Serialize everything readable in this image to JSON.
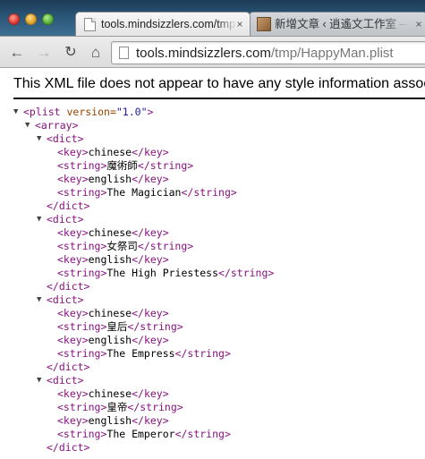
{
  "window": {
    "tabs": [
      {
        "title": "tools.mindsizzlers.com/tmp",
        "close": "×"
      },
      {
        "title": "新增文章 ‹ 逍遙文工作室 — WordPress",
        "close": "×"
      }
    ]
  },
  "toolbar": {
    "back_glyph": "←",
    "forward_glyph": "→",
    "reload_glyph": "↻",
    "home_glyph": "⌂",
    "url_host": "tools.mindsizzlers.com",
    "url_path": "/tmp/HappyMan.plist"
  },
  "notice": "This XML file does not appear to have any style information associated with it. The document tree is shown below.",
  "xml": {
    "arrow": "▼",
    "plist_open": "<plist",
    "version_attr": "version=",
    "version_value": "\"1.0\"",
    "gt": ">",
    "array_open": "<array>",
    "dict_open": "<dict>",
    "dict_close": "</dict>",
    "key_open": "<key>",
    "key_close": "</key>",
    "string_open": "<string>",
    "string_close": "</string>",
    "key_chinese": "chinese",
    "key_english": "english",
    "entries": [
      {
        "chinese": "魔術師",
        "english": "The Magician"
      },
      {
        "chinese": "女祭司",
        "english": "The High Priestess"
      },
      {
        "chinese": "皇后",
        "english": "The Empress"
      },
      {
        "chinese": "皇帝",
        "english": "The Emperor"
      }
    ]
  },
  "colors": {
    "tag": "#881280",
    "attribute_name": "#994500",
    "attribute_value": "#1a1aa6",
    "titlebar_background": "#2a5577"
  }
}
